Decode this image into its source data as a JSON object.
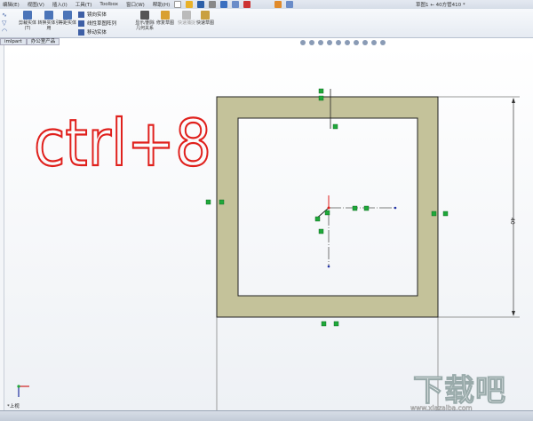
{
  "menu": [
    "编辑(E)",
    "视图(V)",
    "插入(I)",
    "工具(T)",
    "Toolbox",
    "窗口(W)",
    "帮助(H)"
  ],
  "window_title": "草图1 ← 40方管410 *",
  "ribbon": {
    "trim": "剪裁实体(T)",
    "convert": "转换实体引用",
    "offset": "等距实体",
    "mirror": "镜向实体",
    "linear_pattern": "线性草图阵列",
    "move": "移动实体",
    "relations": "显示/删除几何关系",
    "repair": "修复草图",
    "quick_snaps": "快速捕捉",
    "rapid_sketch": "快速草图"
  },
  "tabs": [
    "imlpart",
    "办公室产品"
  ],
  "annotation": "ctrl+8",
  "dimension": "40",
  "view_label": "*上视",
  "watermark": "下载吧",
  "watermark_url": "www.xiazaiba.com",
  "colors": {
    "profile_fill": "#c4c29a",
    "relation_green": "#1fa83a",
    "annotation_red": "#e0201c"
  }
}
